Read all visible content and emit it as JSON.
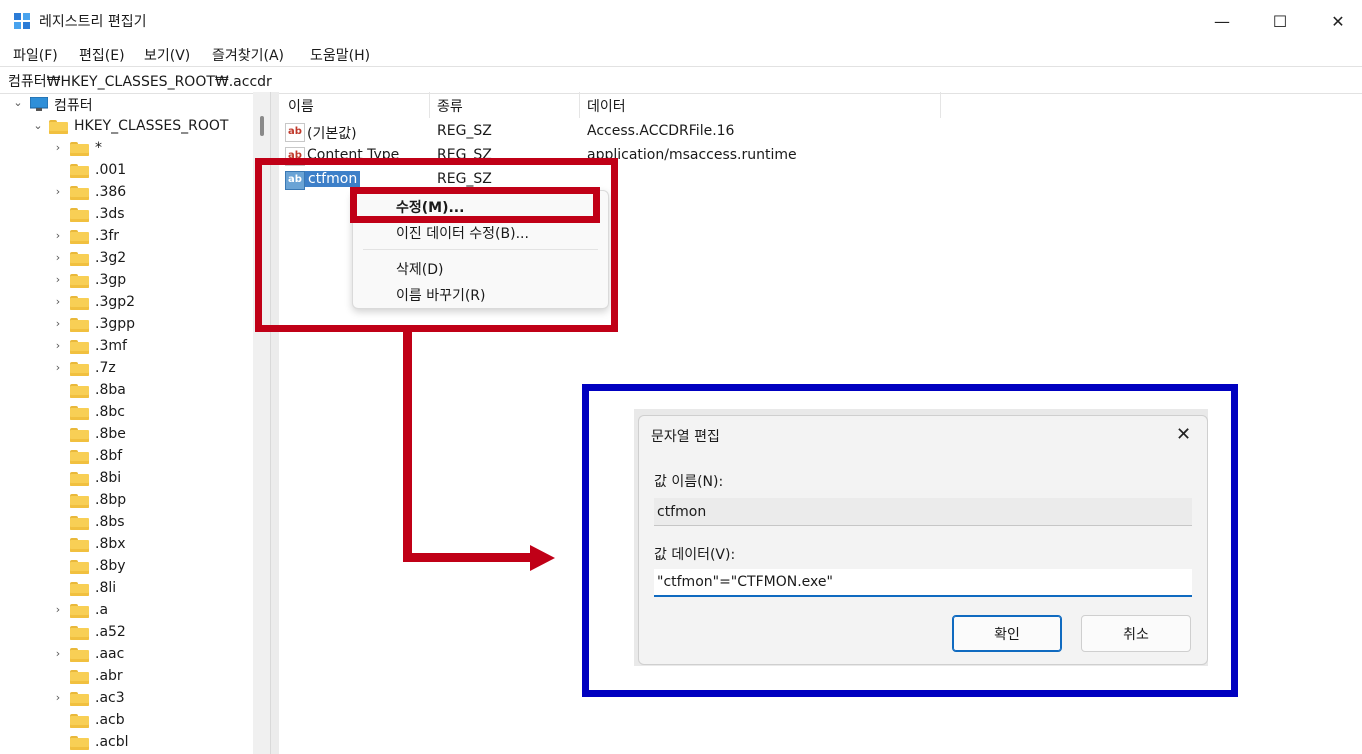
{
  "window": {
    "title": "레지스트리 편집기",
    "minimize": "—",
    "maximize": "☐",
    "close": "✕"
  },
  "menu": [
    "파일(F)",
    "편집(E)",
    "보기(V)",
    "즐겨찾기(A)",
    "도움말(H)"
  ],
  "address": "컴퓨터₩HKEY_CLASSES_ROOT₩.accdr",
  "tree": {
    "computer": "컴퓨터",
    "root": "HKEY_CLASSES_ROOT",
    "items": [
      {
        "label": "*",
        "expandable": true
      },
      {
        "label": ".001",
        "expandable": false
      },
      {
        "label": ".386",
        "expandable": true
      },
      {
        "label": ".3ds",
        "expandable": false
      },
      {
        "label": ".3fr",
        "expandable": true
      },
      {
        "label": ".3g2",
        "expandable": true
      },
      {
        "label": ".3gp",
        "expandable": true
      },
      {
        "label": ".3gp2",
        "expandable": true
      },
      {
        "label": ".3gpp",
        "expandable": true
      },
      {
        "label": ".3mf",
        "expandable": true
      },
      {
        "label": ".7z",
        "expandable": true
      },
      {
        "label": ".8ba",
        "expandable": false
      },
      {
        "label": ".8bc",
        "expandable": false
      },
      {
        "label": ".8be",
        "expandable": false
      },
      {
        "label": ".8bf",
        "expandable": false
      },
      {
        "label": ".8bi",
        "expandable": false
      },
      {
        "label": ".8bp",
        "expandable": false
      },
      {
        "label": ".8bs",
        "expandable": false
      },
      {
        "label": ".8bx",
        "expandable": false
      },
      {
        "label": ".8by",
        "expandable": false
      },
      {
        "label": ".8li",
        "expandable": false
      },
      {
        "label": ".a",
        "expandable": true
      },
      {
        "label": ".a52",
        "expandable": false
      },
      {
        "label": ".aac",
        "expandable": true
      },
      {
        "label": ".abr",
        "expandable": false
      },
      {
        "label": ".ac3",
        "expandable": true
      },
      {
        "label": ".acb",
        "expandable": false
      },
      {
        "label": ".acbl",
        "expandable": false
      }
    ]
  },
  "list": {
    "headers": {
      "name": "이름",
      "type": "종류",
      "data": "데이터"
    },
    "rows": [
      {
        "name": "(기본값)",
        "type": "REG_SZ",
        "data": "Access.ACCDRFile.16",
        "icon": "ab-icon"
      },
      {
        "name": "Content Type",
        "type": "REG_SZ",
        "data": "application/msaccess.runtime",
        "icon": "ab-icon"
      },
      {
        "name": "ctfmon",
        "type": "REG_SZ",
        "data": "",
        "icon": "ab-icon",
        "selected": true
      }
    ]
  },
  "context_menu": {
    "modify": "수정(M)...",
    "modify_binary": "이진 데이터 수정(B)...",
    "delete": "삭제(D)",
    "rename": "이름 바꾸기(R)"
  },
  "dialog": {
    "title": "문자열 편집",
    "close": "✕",
    "value_name_label": "값 이름(N):",
    "value_name": "ctfmon",
    "value_data_label": "값 데이터(V):",
    "value_data": "\"ctfmon\"=\"CTFMON.exe\"",
    "ok": "확인",
    "cancel": "취소"
  },
  "colors": {
    "annotation_red": "#c00017",
    "annotation_blue": "#0000c0",
    "selection": "#3d7fc8",
    "accent": "#0f6ac0"
  }
}
